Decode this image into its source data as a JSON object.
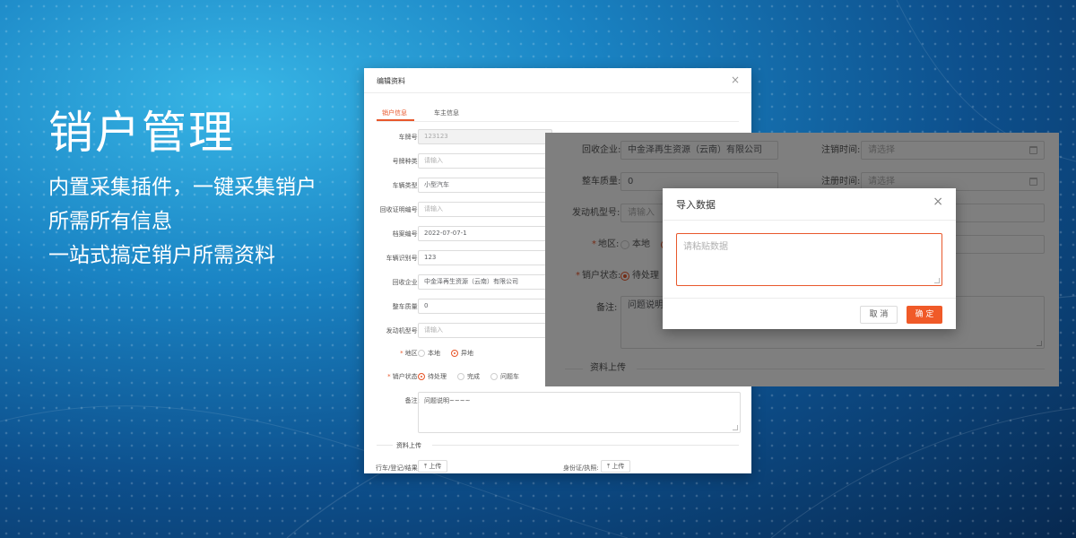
{
  "hero": {
    "title": "销户管理",
    "line1": "内置采集插件，一键采集销户",
    "line2": "所需所有信息",
    "line3": "一站式搞定销户所需资料"
  },
  "edit_window": {
    "title": "编辑资料",
    "close": "×",
    "tabs": [
      {
        "label": "销户信息",
        "active": true
      },
      {
        "label": "车主信息",
        "active": false
      }
    ],
    "fields": [
      {
        "label": "车牌号:",
        "value": "123123",
        "state": "disabled"
      },
      {
        "label": "号牌种类:",
        "value": "请输入",
        "state": "placeholder"
      },
      {
        "label": "车辆类型:",
        "value": "小型汽车",
        "state": "filled"
      },
      {
        "label": "回收证明编号:",
        "value": "请输入",
        "state": "placeholder"
      },
      {
        "label": "档案编号:",
        "value": "2022-07-07-1",
        "state": "filled"
      },
      {
        "label": "车辆识别号:",
        "value": "123",
        "state": "filled"
      },
      {
        "label": "回收企业:",
        "value": "中金泽再生资源（云南）有限公司",
        "state": "filled"
      },
      {
        "label": "整车质量:",
        "value": "0",
        "state": "filled"
      },
      {
        "label": "发动机型号:",
        "value": "请输入",
        "state": "placeholder"
      }
    ],
    "region": {
      "label": "地区:",
      "options": [
        "本地",
        "异地"
      ],
      "selected": "异地"
    },
    "status": {
      "label": "销户状态:",
      "options": [
        "待处理",
        "完成",
        "问题车"
      ],
      "selected": "待处理"
    },
    "remark": {
      "label": "备注:",
      "value": "问题说明~~~~"
    },
    "upload_section": {
      "title": "资料上传",
      "items": [
        {
          "label": "行车/登记/结果:",
          "button": "上传"
        },
        {
          "label": "身份证/执照:",
          "button": "上传"
        }
      ],
      "upload_icon": "upload-arrow-icon"
    }
  },
  "form_window": {
    "recycler": {
      "label": "回收企业:",
      "value": "中金泽再生资源（云南）有限公司"
    },
    "cancel_time": {
      "label": "注销时间:",
      "placeholder": "请选择"
    },
    "vehicle_mass": {
      "label": "整车质量:",
      "value": "0"
    },
    "register_time": {
      "label": "注册时间:",
      "placeholder": "请选择"
    },
    "engine_model": {
      "label": "发动机型号:",
      "placeholder": "请输入"
    },
    "region": {
      "label": "地区:",
      "option_local": "本地"
    },
    "status": {
      "label": "销户状态:",
      "option": "待处理"
    },
    "remark": {
      "label": "备注:",
      "value": "问题说明~"
    },
    "upload_title": "资料上传",
    "calendar_icon": "calendar-icon",
    "mask_color": "#000000"
  },
  "import_dialog": {
    "title": "导入数据",
    "close": "×",
    "placeholder": "请粘贴数据",
    "cancel_label": "取 消",
    "confirm_label": "确 定"
  },
  "colors": {
    "accent": "#e8582c",
    "confirm_button": "#f05a28",
    "background_dark": "#07284f",
    "background_light": "#38b6e6"
  }
}
